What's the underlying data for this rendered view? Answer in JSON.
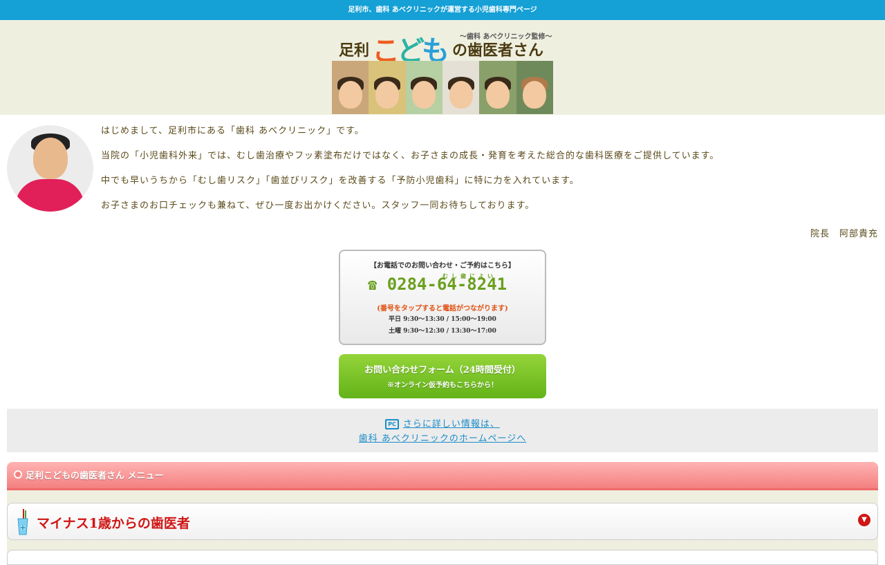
{
  "topbar": {
    "text": "足利市、歯科 あべクリニックが運営する小児歯科専門ページ"
  },
  "logo": {
    "sub": "〜歯科 あべクリニック監修〜",
    "prefix": "足利",
    "kids": [
      "こ",
      "ど",
      "も"
    ],
    "suffix": "の歯医者さん"
  },
  "intro": {
    "paragraphs": [
      "はじめまして、足利市にある「歯科 あべクリニック」です。",
      "当院の「小児歯科外来」では、むし歯治療やフッ素塗布だけではなく、お子さまの成長・発育を考えた総合的な歯科医療をご提供しています。",
      "中でも早いうちから「むし歯リスク」「歯並びリスク」を改善する「予防小児歯科」に特に力を入れています。",
      "お子さまのお口チェックも兼ねて、ぜひ一度お出かけください。スタッフ一同お待ちしております。"
    ],
    "signature": "院長　阿部貴充"
  },
  "phone": {
    "title": "【お電話でのお問い合わせ・ご予約はこちら】",
    "icon": "☎",
    "ruby": "むし歯によい",
    "number": "0284-64-8241",
    "note": "(番号をタップすると電話がつながります)",
    "hours_weekday": "平日 9:30～13:30 / 15:00～19:00",
    "hours_saturday": "土曜 9:30～12:30 / 13:30～17:00"
  },
  "contact": {
    "main": "お問い合わせフォーム（24時間受付）",
    "sub": "※オンライン仮予約もこちらから！"
  },
  "homepage_link": {
    "icon_label": "PC",
    "line1": "さらに詳しい情報は、",
    "line2": "歯科 あべクリニックのホームページへ"
  },
  "menu": {
    "title": "足利こどもの歯医者さん メニュー",
    "items": [
      {
        "label": "マイナス1歳からの歯医者",
        "icon": "toothbrush-cup-icon",
        "arrow": "▼"
      }
    ]
  },
  "colors": {
    "topbar": "#15a0d6",
    "header_bg": "#efefe0",
    "text": "#5a4a1a",
    "phone_green": "#6aa01e",
    "button_green": "#63b318",
    "menu_pink": "#f48080",
    "menu_item_red": "#d01515",
    "link_blue": "#1a8cc8"
  }
}
